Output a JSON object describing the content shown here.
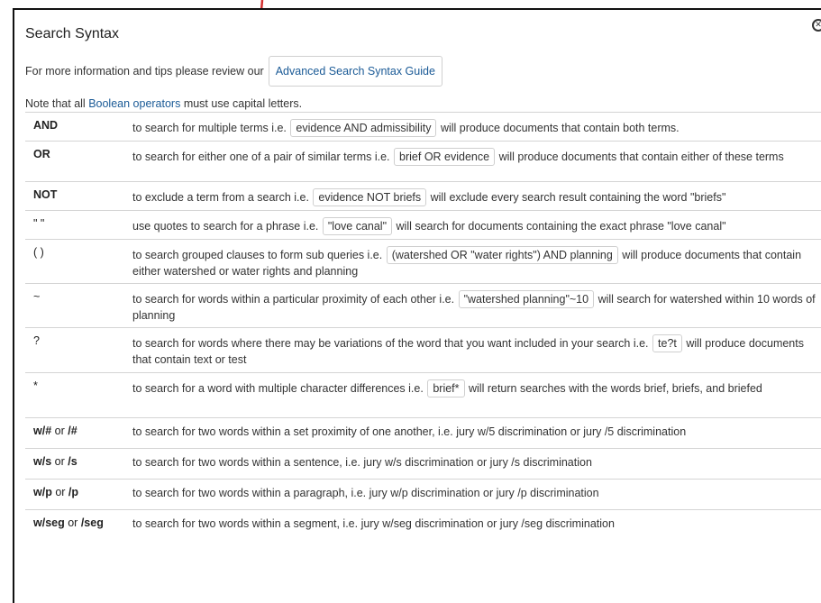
{
  "title": "Search Syntax",
  "intro": {
    "text": "For more information and tips please review our",
    "guide_button": "Advanced Search Syntax Guide"
  },
  "note": {
    "before": "Note that all ",
    "link": "Boolean operators",
    "after": " must use capital letters."
  },
  "close_icon": "close-icon",
  "arrow_color": "#d32f2f",
  "link_color": "#1a5a96",
  "rows": [
    {
      "op": "AND",
      "pre": "to search for multiple terms i.e.",
      "code": "evidence AND admissibility",
      "post": "will produce documents that contain both terms."
    },
    {
      "op": "OR",
      "pre": "to search for either one of a pair of similar terms i.e.",
      "code": "brief OR evidence",
      "post": "will produce documents that contain either of these terms"
    },
    {
      "op": "NOT",
      "pre": "to exclude a term from a search i.e.",
      "code": "evidence NOT briefs",
      "post": "will exclude every search result containing the word \"briefs\""
    },
    {
      "op": "\" \"",
      "pre": "use quotes to search for a phrase i.e.",
      "code": "\"love canal\"",
      "post": "will search for documents containing the exact phrase \"love canal\""
    },
    {
      "op": "( )",
      "pre": "to search grouped clauses to form sub queries i.e.",
      "code": "(watershed OR \"water rights\") AND planning",
      "post": "will produce documents that contain either watershed or water rights and planning"
    },
    {
      "op": "~",
      "pre": "to search for words within a particular proximity of each other i.e.",
      "code": "\"watershed planning\"~10",
      "post": "will search for watershed within 10 words of planning"
    },
    {
      "op": "?",
      "pre": "to search for words where there may be variations of the word that you want included in your search i.e.",
      "code": "te?t",
      "post": "will produce documents that contain text or test"
    },
    {
      "op": "*",
      "pre": "to search for a word with multiple character differences i.e.",
      "code": "brief*",
      "post": "will return searches with the words brief, briefs, and briefed"
    },
    {
      "op_a": "w/#",
      "or": " or ",
      "op_b": "/#",
      "text": "to search for two words within a set proximity of one another, i.e. jury w/5 discrimination or jury /5 discrimination"
    },
    {
      "op_a": "w/s",
      "or": " or ",
      "op_b": "/s",
      "text": "to search for two words within a sentence, i.e. jury w/s discrimination or jury /s discrimination"
    },
    {
      "op_a": "w/p",
      "or": " or ",
      "op_b": "/p",
      "text": "to search for two words within a paragraph, i.e. jury w/p discrimination or jury /p discrimination"
    },
    {
      "op_a": "w/seg",
      "or": " or ",
      "op_b": "/seg",
      "text": "to search for two words within a segment, i.e. jury w/seg discrimination or jury /seg discrimination"
    }
  ]
}
